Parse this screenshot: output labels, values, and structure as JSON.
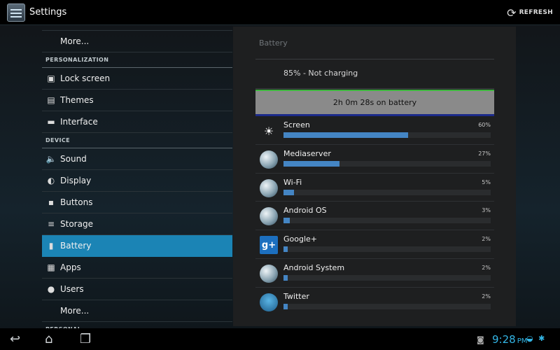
{
  "actionbar": {
    "title": "Settings",
    "refresh_label": "REFRESH"
  },
  "sidebar": {
    "items": [
      {
        "type": "more",
        "label": "More..."
      },
      {
        "type": "header",
        "label": "PERSONALIZATION"
      },
      {
        "type": "item",
        "label": "Lock screen",
        "icon": "lock-screen-icon",
        "glyph": "▣"
      },
      {
        "type": "item",
        "label": "Themes",
        "icon": "themes-icon",
        "glyph": "▤"
      },
      {
        "type": "item",
        "label": "Interface",
        "icon": "interface-icon",
        "glyph": "▬"
      },
      {
        "type": "header",
        "label": "DEVICE"
      },
      {
        "type": "item",
        "label": "Sound",
        "icon": "speaker-icon",
        "glyph": "🔈"
      },
      {
        "type": "item",
        "label": "Display",
        "icon": "display-icon",
        "glyph": "◐"
      },
      {
        "type": "item",
        "label": "Buttons",
        "icon": "buttons-icon",
        "glyph": "▪"
      },
      {
        "type": "item",
        "label": "Storage",
        "icon": "storage-icon",
        "glyph": "≡"
      },
      {
        "type": "item",
        "label": "Battery",
        "icon": "battery-icon",
        "glyph": "▮",
        "selected": true
      },
      {
        "type": "item",
        "label": "Apps",
        "icon": "apps-icon",
        "glyph": "▦"
      },
      {
        "type": "item",
        "label": "Users",
        "icon": "users-icon",
        "glyph": "●"
      },
      {
        "type": "more",
        "label": "More..."
      },
      {
        "type": "header",
        "label": "PERSONAL"
      }
    ]
  },
  "battery": {
    "title": "Battery",
    "status": "85% - Not charging",
    "graph_label": "2h 0m 28s on battery",
    "usage": [
      {
        "name": "Screen",
        "percent": 60,
        "percent_label": "60%",
        "icon": "screen-brightness-icon",
        "kind": "screen",
        "glyph": "☀"
      },
      {
        "name": "Mediaserver",
        "percent": 27,
        "percent_label": "27%",
        "icon": "android-system-icon",
        "kind": "sys",
        "glyph": ""
      },
      {
        "name": "Wi-Fi",
        "percent": 5,
        "percent_label": "5%",
        "icon": "wifi-icon",
        "kind": "sys",
        "glyph": ""
      },
      {
        "name": "Android OS",
        "percent": 3,
        "percent_label": "3%",
        "icon": "android-os-icon",
        "kind": "sys",
        "glyph": ""
      },
      {
        "name": "Google+",
        "percent": 2,
        "percent_label": "2%",
        "icon": "google-plus-icon",
        "kind": "gplus",
        "glyph": "g+"
      },
      {
        "name": "Android System",
        "percent": 2,
        "percent_label": "2%",
        "icon": "android-system-icon",
        "kind": "sys",
        "glyph": ""
      },
      {
        "name": "Twitter",
        "percent": 2,
        "percent_label": "2%",
        "icon": "twitter-bird-icon",
        "kind": "twitter",
        "glyph": ""
      }
    ]
  },
  "statusbar": {
    "time": "9:28",
    "ampm": "PM"
  }
}
